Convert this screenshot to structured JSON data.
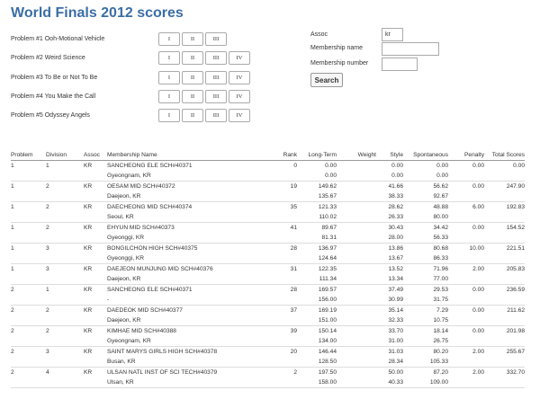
{
  "page": {
    "title": "World Finals 2012 scores"
  },
  "problems": [
    {
      "label": "Problem #1 Ooh-Motional Vehicle",
      "buttons": [
        "I",
        "II",
        "III"
      ]
    },
    {
      "label": "Problem #2 Weird Science",
      "buttons": [
        "I",
        "II",
        "III",
        "IV"
      ]
    },
    {
      "label": "Problem #3 To Be or Not To Be",
      "buttons": [
        "I",
        "II",
        "III",
        "IV"
      ]
    },
    {
      "label": "Problem #4 You Make the Call",
      "buttons": [
        "I",
        "II",
        "III",
        "IV"
      ]
    },
    {
      "label": "Problem #5 Odyssey Angels",
      "buttons": [
        "I",
        "II",
        "III",
        "IV"
      ]
    }
  ],
  "filters": {
    "assoc_label": "Assoc",
    "assoc_value": "kr",
    "membership_name_label": "Membership name",
    "membership_name_value": "",
    "membership_number_label": "Membership number",
    "membership_number_value": "",
    "search_label": "Search"
  },
  "table": {
    "headers": [
      "Problem",
      "Division",
      "Assoc",
      "Membership Name",
      "Rank",
      "Long-Term",
      "Weight",
      "Style",
      "Spontaneous",
      "Penalty",
      "Total Scores"
    ],
    "rows": [
      {
        "problem": "1",
        "division": "1",
        "assoc": "KR",
        "name": "SANCHEONG ELE SCH#40371",
        "location": "Gyeongnam, KR",
        "rank": "0",
        "lt1": "0.00",
        "lt2": "0.00",
        "weight": "",
        "style1": "0.00",
        "style2": "0.00",
        "spont1": "0.00",
        "spont2": "0.00",
        "penalty": "0.00",
        "total": "0.00"
      },
      {
        "problem": "1",
        "division": "2",
        "assoc": "KR",
        "name": "OESAM MID SCH#40372",
        "location": "Daejeon, KR",
        "rank": "19",
        "lt1": "149.62",
        "lt2": "135.67",
        "weight": "",
        "style1": "41.66",
        "style2": "38.33",
        "spont1": "56.62",
        "spont2": "92.67",
        "penalty": "0.00",
        "total": "247.90"
      },
      {
        "problem": "1",
        "division": "2",
        "assoc": "KR",
        "name": "DAECHEONG MID SCH#40374",
        "location": "Seoul, KR",
        "rank": "35",
        "lt1": "121.33",
        "lt2": "110.02",
        "weight": "",
        "style1": "28.62",
        "style2": "26.33",
        "spont1": "48.88",
        "spont2": "80.00",
        "penalty": "6.00",
        "total": "192.83"
      },
      {
        "problem": "1",
        "division": "2",
        "assoc": "KR",
        "name": "EHYUN MID SCH#40373",
        "location": "Gyeonggi, KR",
        "rank": "41",
        "lt1": "89.67",
        "lt2": "81.31",
        "weight": "",
        "style1": "30.43",
        "style2": "28.00",
        "spont1": "34.42",
        "spont2": "56.33",
        "penalty": "0.00",
        "total": "154.52"
      },
      {
        "problem": "1",
        "division": "3",
        "assoc": "KR",
        "name": "BONGILCHON HIGH SCH#40375",
        "location": "Gyeonggi, KR",
        "rank": "28",
        "lt1": "136.97",
        "lt2": "124.64",
        "weight": "",
        "style1": "13.86",
        "style2": "13.67",
        "spont1": "80.68",
        "spont2": "86.33",
        "penalty": "10.00",
        "total": "221.51"
      },
      {
        "problem": "1",
        "division": "3",
        "assoc": "KR",
        "name": "DAEJEON MUNJUNG MID SCH#40376",
        "location": "Daejeon, KR",
        "rank": "31",
        "lt1": "122.35",
        "lt2": "111.34",
        "weight": "",
        "style1": "13.52",
        "style2": "13.34",
        "spont1": "71.96",
        "spont2": "77.00",
        "penalty": "2.00",
        "total": "205.83"
      },
      {
        "problem": "2",
        "division": "1",
        "assoc": "KR",
        "name": "SANCHEONG ELE SCH#40371",
        "location": "-",
        "rank": "28",
        "lt1": "169.57",
        "lt2": "156.00",
        "weight": "",
        "style1": "37.49",
        "style2": "30.99",
        "spont1": "29.53",
        "spont2": "31.75",
        "penalty": "0.00",
        "total": "236.59"
      },
      {
        "problem": "2",
        "division": "2",
        "assoc": "KR",
        "name": "DAEDEOK MID SCH#40377",
        "location": "Daejeon, KR",
        "rank": "37",
        "lt1": "169.19",
        "lt2": "151.00",
        "weight": "",
        "style1": "35.14",
        "style2": "32.33",
        "spont1": "7.29",
        "spont2": "10.75",
        "penalty": "0.00",
        "total": "211.62"
      },
      {
        "problem": "2",
        "division": "2",
        "assoc": "KR",
        "name": "KIMHAE MID SCH#40388",
        "location": "Gyeongnam, KR",
        "rank": "39",
        "lt1": "150.14",
        "lt2": "134.00",
        "weight": "",
        "style1": "33.70",
        "style2": "31.00",
        "spont1": "18.14",
        "spont2": "26.75",
        "penalty": "0.00",
        "total": "201.98"
      },
      {
        "problem": "2",
        "division": "3",
        "assoc": "KR",
        "name": "SAINT MARYS GIRLS HIGH SCH#40378",
        "location": "Busan, KR",
        "rank": "20",
        "lt1": "146.44",
        "lt2": "128.50",
        "weight": "",
        "style1": "31.03",
        "style2": "28.34",
        "spont1": "80.20",
        "spont2": "105.33",
        "penalty": "2.00",
        "total": "255.67"
      },
      {
        "problem": "2",
        "division": "4",
        "assoc": "KR",
        "name": "ULSAN NATL INST OF SCI TECH#40379",
        "location": "Ulsan, KR",
        "rank": "2",
        "lt1": "197.50",
        "lt2": "158.00",
        "weight": "",
        "style1": "50.00",
        "style2": "40.33",
        "spont1": "87.20",
        "spont2": "109.00",
        "penalty": "2.00",
        "total": "332.70"
      }
    ]
  }
}
